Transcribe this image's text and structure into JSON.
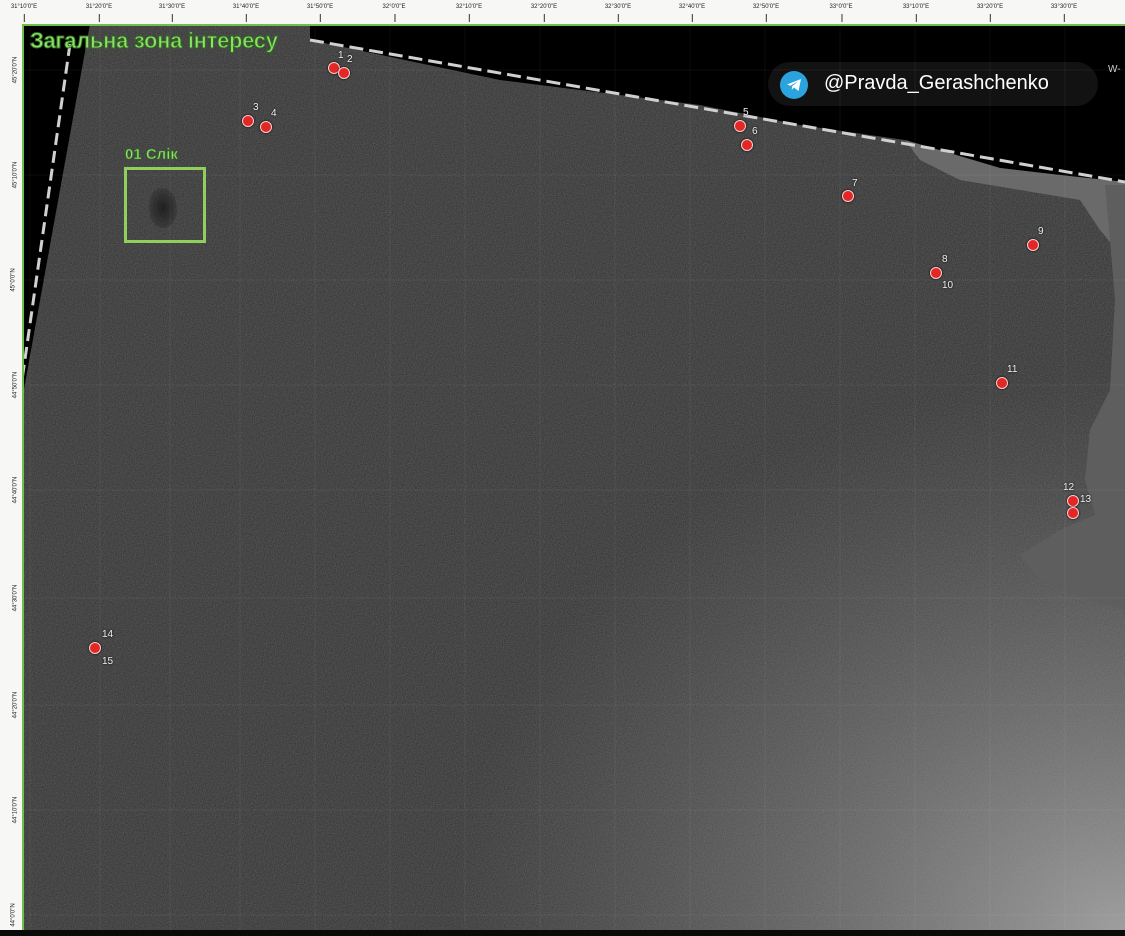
{
  "map": {
    "title": "Загальна зона інтересу",
    "slick_label": "01 Слік",
    "watermark": "@Pravda_Gerashchenko",
    "edge_label": "W-",
    "lon_ticks": [
      "31°10'0\"E",
      "31°20'0\"E",
      "31°30'0\"E",
      "31°40'0\"E",
      "31°50'0\"E",
      "32°0'0\"E",
      "32°10'0\"E",
      "32°20'0\"E",
      "32°30'0\"E",
      "32°40'0\"E",
      "32°50'0\"E",
      "33°0'0\"E",
      "33°10'0\"E",
      "33°20'0\"E",
      "33°30'0\"E"
    ],
    "lat_ticks": [
      "45°20'0\"N",
      "45°10'0\"N",
      "45°0'0\"N",
      "44°50'0\"N",
      "44°40'0\"N",
      "44°30'0\"N",
      "44°20'0\"N",
      "44°10'0\"N",
      "44°0'0\"N"
    ],
    "points": [
      {
        "label": "1"
      },
      {
        "label": "2"
      },
      {
        "label": "3"
      },
      {
        "label": "4"
      },
      {
        "label": "5"
      },
      {
        "label": "6"
      },
      {
        "label": "7"
      },
      {
        "label": "8"
      },
      {
        "label": "9"
      },
      {
        "label": "10"
      },
      {
        "label": "11"
      },
      {
        "label": "12"
      },
      {
        "label": "13"
      },
      {
        "label": "14"
      },
      {
        "label": "15"
      }
    ],
    "colors": {
      "aoi": "#8fe06a",
      "point": "#e32626",
      "watermark_icon": "#2aa3de"
    }
  }
}
